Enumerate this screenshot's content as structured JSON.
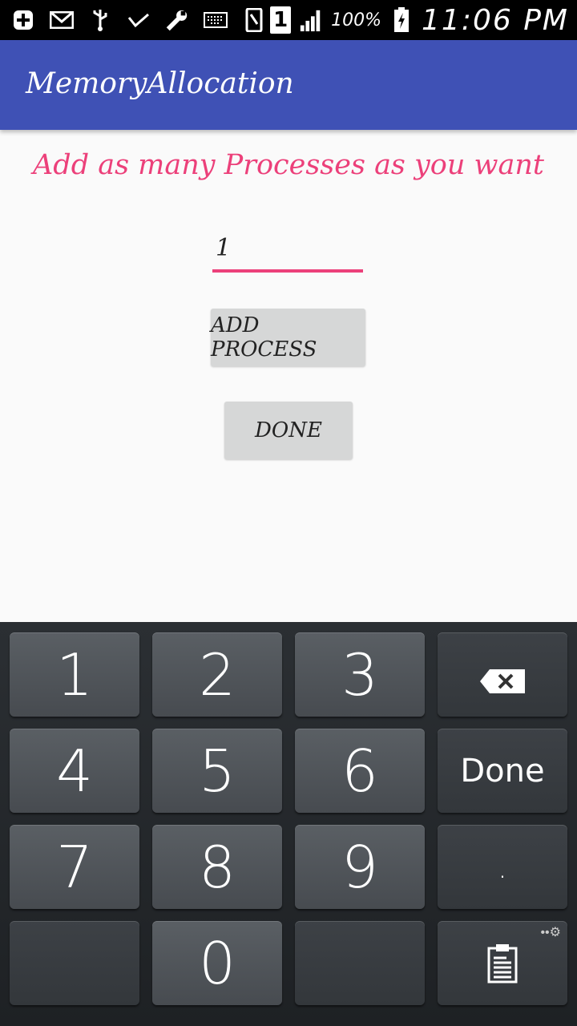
{
  "status_bar": {
    "sim_label": "1",
    "battery_percent": "100%",
    "time": "11:06 PM"
  },
  "app_bar": {
    "title": "MemoryAllocation"
  },
  "main": {
    "heading": "Add as many Processes as you want",
    "process_input_value": "1",
    "add_process_label": "ADD PROCESS",
    "done_label": "DONE"
  },
  "keyboard": {
    "k1": "1",
    "k2": "2",
    "k3": "3",
    "k4": "4",
    "k5": "5",
    "k6": "6",
    "k7": "7",
    "k8": "8",
    "k9": "9",
    "k0": "0",
    "done": "Done",
    "dot": "."
  }
}
